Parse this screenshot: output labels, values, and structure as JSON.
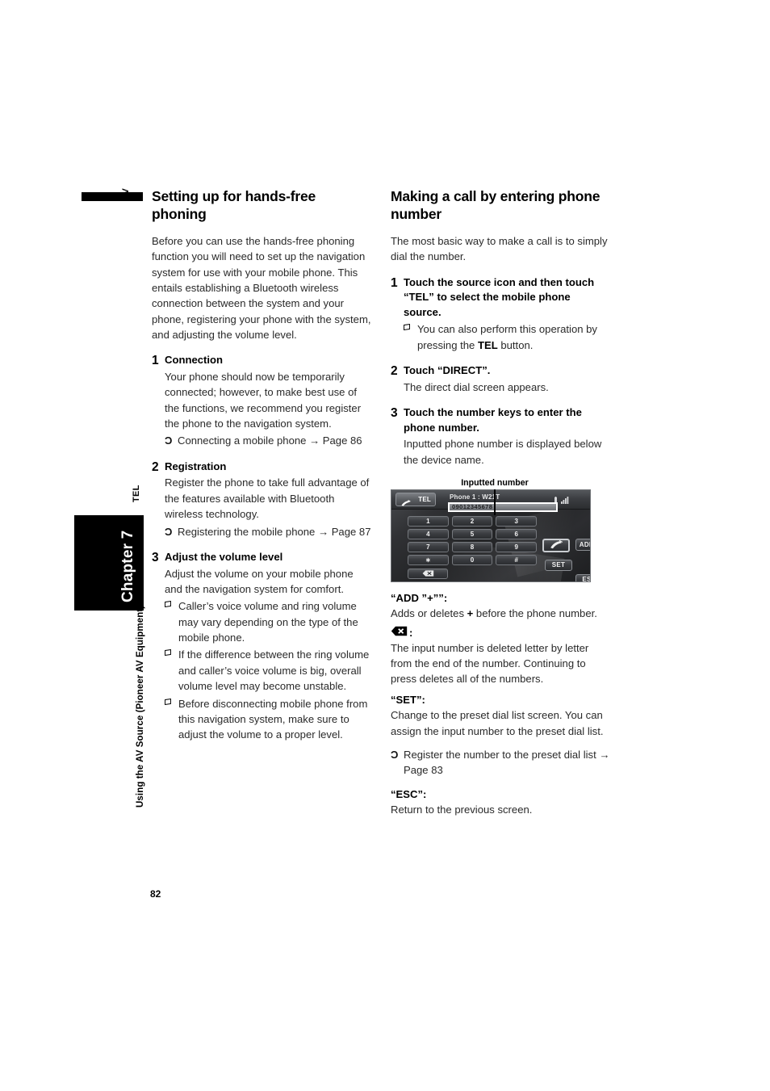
{
  "sidebar": {
    "av_label": "AV",
    "tel_label": "TEL",
    "chapter_label": "Chapter 7",
    "running_head": "Using the AV Source (Pioneer AV Equipment)",
    "page_number": "82"
  },
  "left_column": {
    "heading": "Setting up for hands-free phoning",
    "intro": "Before you can use the hands-free phoning function you will need to set up the navigation system for use with your mobile phone. This entails establishing a Bluetooth wireless connection between the system and your phone, registering your phone with the system, and adjusting the volume level.",
    "steps": [
      {
        "num": "1",
        "title": "Connection",
        "text": "Your phone should now be temporarily connected; however, to make best use of the functions, we recommend you register the phone to the navigation system.",
        "xref": "Connecting a mobile phone → Page 86"
      },
      {
        "num": "2",
        "title": "Registration",
        "text": "Register the phone to take full advantage of the features available with Bluetooth wireless technology.",
        "xref": "Registering the mobile phone → Page 87"
      },
      {
        "num": "3",
        "title": "Adjust the volume level",
        "text": "Adjust the volume on your mobile phone and the navigation system for comfort.",
        "notes": [
          "Caller’s voice volume and ring volume may vary depending on the type of the mobile phone.",
          "If the difference between the ring volume and caller’s voice volume is big, overall volume level may become unstable.",
          "Before disconnecting mobile phone from this navigation system, make sure to adjust the volume to a proper level."
        ]
      }
    ]
  },
  "right_column": {
    "heading": "Making a call by entering phone number",
    "intro": "The most basic way to make a call is to simply dial the number.",
    "steps": [
      {
        "num": "1",
        "title": "Touch the source icon and then touch “TEL” to select the mobile phone source.",
        "note_prefix": "You can also perform this operation by pressing the ",
        "note_bold": "TEL",
        "note_suffix": " button."
      },
      {
        "num": "2",
        "title": "Touch “DIRECT”.",
        "text": "The direct dial screen appears."
      },
      {
        "num": "3",
        "title": "Touch the number keys to enter the phone number.",
        "text": "Inputted phone number is displayed below the device name."
      }
    ],
    "figure": {
      "caption": "Inputted number",
      "device_name": "Phone 1 : W21T",
      "inputted_number": "09012345678",
      "source_label": "TEL",
      "keys": [
        "1",
        "2",
        "3",
        "4",
        "5",
        "6",
        "7",
        "8",
        "9",
        "∗",
        "0",
        "#"
      ],
      "side_buttons": {
        "call": "call-icon",
        "add": "ADD",
        "add_plus": "“+”",
        "set": "SET",
        "esc": "ESC"
      }
    },
    "definitions": [
      {
        "term": "“ADD ”+””:",
        "text_before": "Adds or deletes ",
        "text_plus": "+",
        "text_after": " before the phone number."
      },
      {
        "term_icon": "backspace-icon",
        "term_colon": ":",
        "text": "The input number is deleted letter by letter from the end of the number. Continuing to press deletes all of the numbers."
      },
      {
        "term": "“SET”:",
        "text": "Change to the preset dial list screen. You can assign the input number to the preset dial list.",
        "xref": "Register the number to the preset dial list → Page 83"
      },
      {
        "term": "“ESC”:",
        "text": "Return to the previous screen."
      }
    ]
  },
  "glyphs": {
    "xref_arrow": "Ɔ",
    "note_square": "❑"
  }
}
